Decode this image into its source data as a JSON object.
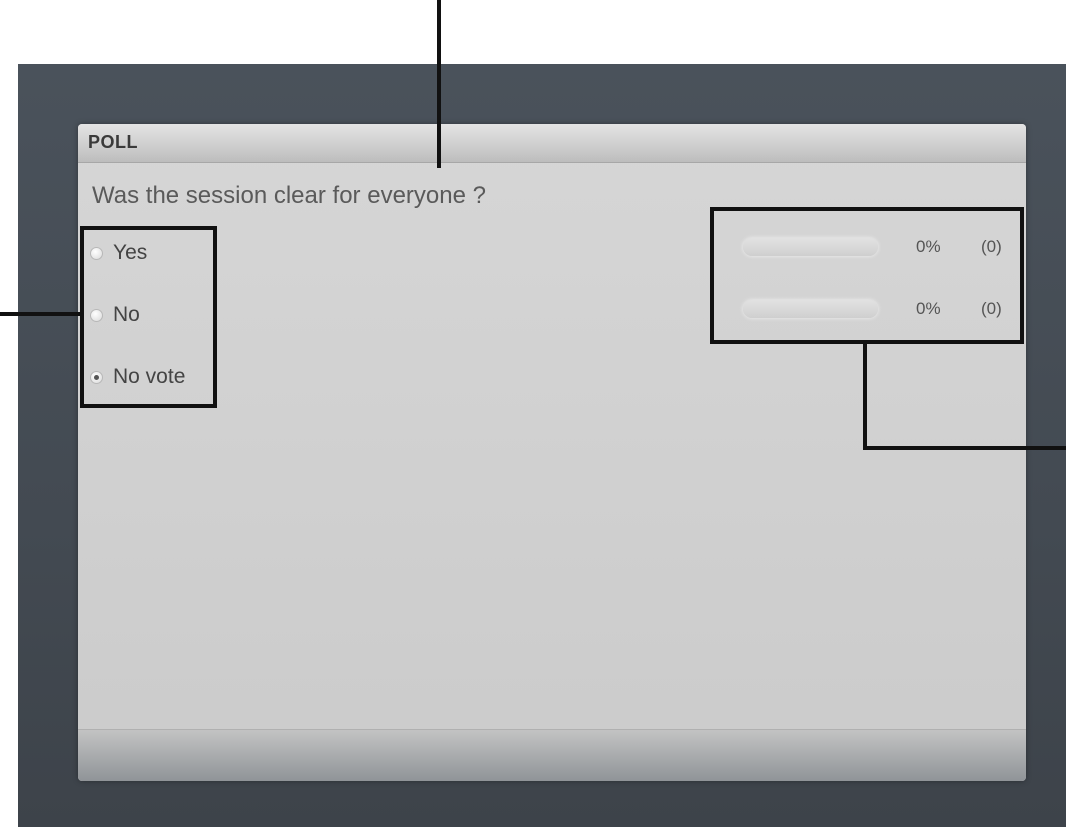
{
  "poll": {
    "title": "POLL",
    "question": "Was the session clear for everyone ?",
    "options": [
      {
        "label": "Yes",
        "checked": false
      },
      {
        "label": "No",
        "checked": false
      },
      {
        "label": "No vote",
        "checked": true
      }
    ],
    "results": [
      {
        "percent": "0%",
        "count": "(0)",
        "fill_fraction": 0
      },
      {
        "percent": "0%",
        "count": "(0)",
        "fill_fraction": 0
      }
    ]
  },
  "colors": {
    "frame": "#434a52",
    "panel": "#cfcfcf",
    "callout": "#111111"
  }
}
